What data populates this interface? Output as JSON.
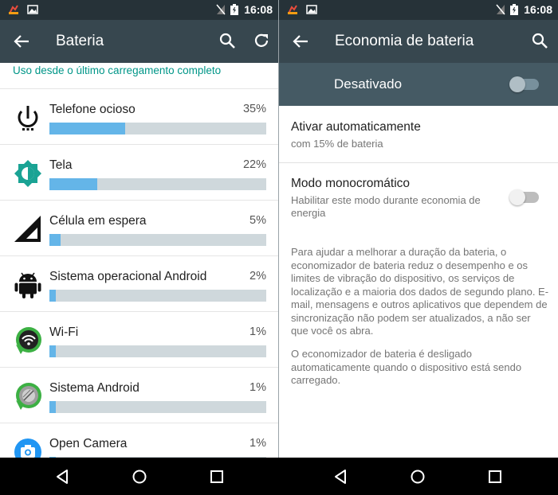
{
  "status": {
    "time": "16:08"
  },
  "left": {
    "title": "Bateria",
    "subheader": "Uso desde o último carregamento completo",
    "items": [
      {
        "name": "Telefone ocioso",
        "percent": "35%",
        "level": 0.35,
        "icon": "power-icon"
      },
      {
        "name": "Tela",
        "percent": "22%",
        "level": 0.22,
        "icon": "brightness-icon"
      },
      {
        "name": "Célula em espera",
        "percent": "5%",
        "level": 0.05,
        "icon": "cell-signal-icon"
      },
      {
        "name": "Sistema operacional Android",
        "percent": "2%",
        "level": 0.02,
        "icon": "android-icon"
      },
      {
        "name": "Wi-Fi",
        "percent": "1%",
        "level": 0.01,
        "icon": "wifi-icon"
      },
      {
        "name": "Sistema Android",
        "percent": "1%",
        "level": 0.01,
        "icon": "android-system-icon"
      },
      {
        "name": "Open Camera",
        "percent": "1%",
        "level": 0.01,
        "icon": "camera-icon"
      }
    ]
  },
  "right": {
    "title": "Economia de bateria",
    "master_label": "Desativado",
    "master_on": false,
    "auto": {
      "title": "Ativar automaticamente",
      "summary": "com 15% de bateria"
    },
    "mono": {
      "title": "Modo monocromático",
      "summary": "Habilitar este modo durante economia de energia",
      "on": false
    },
    "description": "Para ajudar a melhorar a duração da bateria, o economizador de bateria reduz o desempenho e os limites de vibração do dispositivo, os serviços de localização e a maioria dos dados de segundo plano. E-mail, mensagens e outros aplicativos que dependem de sincronização não podem ser atualizados, a não ser que você os abra.",
    "note": "O economizador de bateria é desligado automaticamente quando o dispositivo está sendo carregado."
  },
  "colors": {
    "accent": "#009688",
    "bar": "#64b5e8",
    "track": "#cfd8dc",
    "appbar": "#37474f",
    "statusbar": "#263238"
  }
}
